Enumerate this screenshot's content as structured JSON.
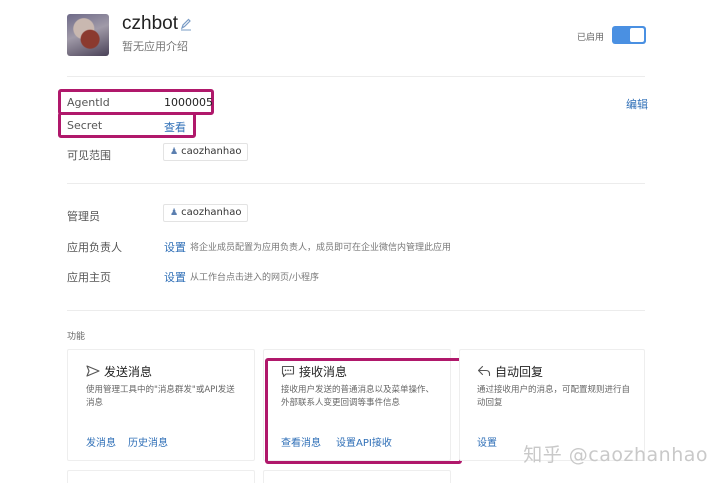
{
  "app": {
    "name": "czhbot",
    "description": "暂无应用介绍",
    "status_label": "已启用",
    "enabled": true
  },
  "info": {
    "edit_label": "编辑",
    "agentid_label": "AgentId",
    "agentid_value": "1000005",
    "secret_label": "Secret",
    "secret_link": "查看",
    "scope_label": "可见范围",
    "scope_value": "caozhanhao"
  },
  "management": {
    "admin_label": "管理员",
    "admin_value": "caozhanhao",
    "owner_label": "应用负责人",
    "owner_link": "设置",
    "owner_hint": "将企业成员配置为应用负责人，成员即可在企业微信内管理此应用",
    "homepage_label": "应用主页",
    "homepage_link": "设置",
    "homepage_hint": "从工作台点击进入的网页/小程序"
  },
  "features": {
    "section_title": "功能",
    "cards": [
      {
        "title": "发送消息",
        "desc_line1": "使用管理工具中的\"消息群发\"或API发送",
        "desc_line2": "消息",
        "links": [
          "发消息",
          "历史消息"
        ],
        "icon": "send-icon"
      },
      {
        "title": "接收消息",
        "desc_line1": "接收用户发送的普通消息以及菜单操作、",
        "desc_line2": "外部联系人变更回调等事件信息",
        "links": [
          "查看消息",
          "设置API接收"
        ],
        "icon": "chat-icon"
      },
      {
        "title": "自动回复",
        "desc_line1": "通过接收用户的消息，可配置规则进行自",
        "desc_line2": "动回复",
        "links": [
          "设置"
        ],
        "icon": "reply-icon"
      }
    ]
  },
  "watermark": "知乎 @caozhanhao",
  "colors": {
    "accent": "#2f6fb7",
    "toggle": "#4a90e2",
    "highlight": "#b0186b"
  }
}
